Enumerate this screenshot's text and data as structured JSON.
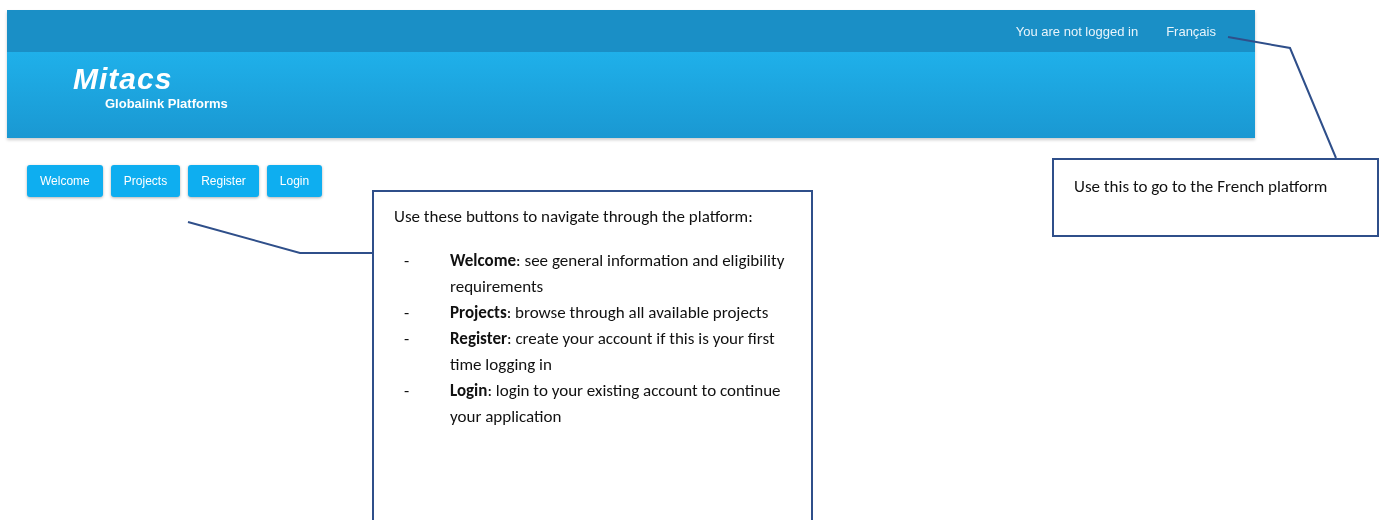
{
  "header": {
    "status": "You are not logged in",
    "language_link": "Français",
    "logo": "Mitacs",
    "subtitle": "Globalink Platforms"
  },
  "nav_buttons": [
    "Welcome",
    "Projects",
    "Register",
    "Login"
  ],
  "callouts": [
    {
      "kind": "list",
      "text": "Use these buttons to navigate through the platform:",
      "items": [
        {
          "bullet": "-",
          "text": "**Welcome**: see general information and eligibility requirements"
        },
        {
          "bullet": "-",
          "text": "**Projects**: browse through all available projects"
        },
        {
          "bullet": "-",
          "text": "**Register**: create your account if this is your first time logging in"
        },
        {
          "bullet": "-",
          "text": "**Login**: login to your existing account to continue your application"
        }
      ]
    },
    {
      "kind": "note",
      "text": "Use this to go to the French platform"
    }
  ]
}
